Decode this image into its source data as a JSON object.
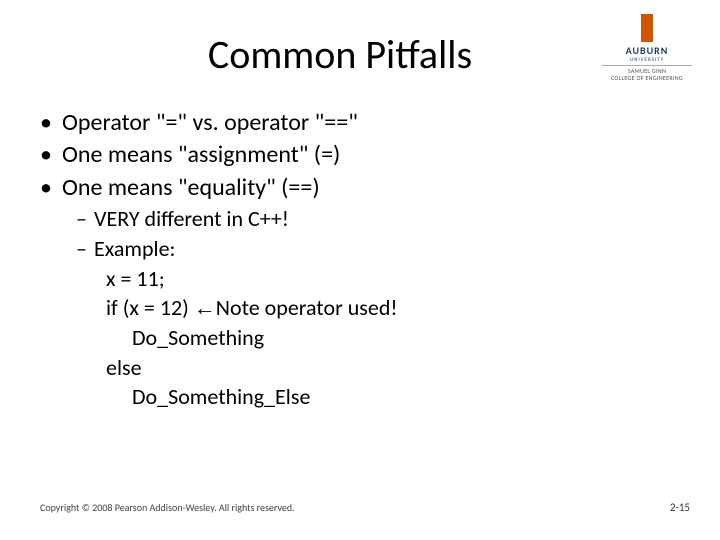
{
  "title": "Common Pitfalls",
  "logo": {
    "name": "AUBURN",
    "sub": "UNIVERSITY",
    "college_l1": "SAMUEL GINN",
    "college_l2": "COLLEGE OF ENGINEERING"
  },
  "bullets": [
    "Operator \"=\" vs. operator \"==\"",
    "One means \"assignment\" (=)",
    "One means \"equality\" (==)"
  ],
  "subs": {
    "s1": "VERY different in C++!",
    "s2": "Example:",
    "c1": "x = 11;",
    "c2_a": "if (x = 12)  ",
    "c2_arrow": "←",
    "c2_b": "Note operator used!",
    "c3": "Do_Something",
    "c4": "else",
    "c5": "Do_Something_Else"
  },
  "footer": {
    "copyright": "Copyright © 2008 Pearson Addison-Wesley. All rights reserved.",
    "page": "2-15"
  }
}
